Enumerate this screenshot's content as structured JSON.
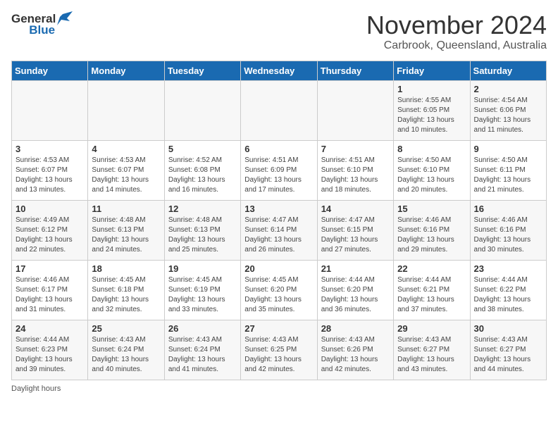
{
  "header": {
    "logo_general": "General",
    "logo_blue": "Blue",
    "title": "November 2024",
    "subtitle": "Carbrook, Queensland, Australia"
  },
  "days_of_week": [
    "Sunday",
    "Monday",
    "Tuesday",
    "Wednesday",
    "Thursday",
    "Friday",
    "Saturday"
  ],
  "weeks": [
    [
      {
        "day": "",
        "info": ""
      },
      {
        "day": "",
        "info": ""
      },
      {
        "day": "",
        "info": ""
      },
      {
        "day": "",
        "info": ""
      },
      {
        "day": "",
        "info": ""
      },
      {
        "day": "1",
        "info": "Sunrise: 4:55 AM\nSunset: 6:05 PM\nDaylight: 13 hours and 10 minutes."
      },
      {
        "day": "2",
        "info": "Sunrise: 4:54 AM\nSunset: 6:06 PM\nDaylight: 13 hours and 11 minutes."
      }
    ],
    [
      {
        "day": "3",
        "info": "Sunrise: 4:53 AM\nSunset: 6:07 PM\nDaylight: 13 hours and 13 minutes."
      },
      {
        "day": "4",
        "info": "Sunrise: 4:53 AM\nSunset: 6:07 PM\nDaylight: 13 hours and 14 minutes."
      },
      {
        "day": "5",
        "info": "Sunrise: 4:52 AM\nSunset: 6:08 PM\nDaylight: 13 hours and 16 minutes."
      },
      {
        "day": "6",
        "info": "Sunrise: 4:51 AM\nSunset: 6:09 PM\nDaylight: 13 hours and 17 minutes."
      },
      {
        "day": "7",
        "info": "Sunrise: 4:51 AM\nSunset: 6:10 PM\nDaylight: 13 hours and 18 minutes."
      },
      {
        "day": "8",
        "info": "Sunrise: 4:50 AM\nSunset: 6:10 PM\nDaylight: 13 hours and 20 minutes."
      },
      {
        "day": "9",
        "info": "Sunrise: 4:50 AM\nSunset: 6:11 PM\nDaylight: 13 hours and 21 minutes."
      }
    ],
    [
      {
        "day": "10",
        "info": "Sunrise: 4:49 AM\nSunset: 6:12 PM\nDaylight: 13 hours and 22 minutes."
      },
      {
        "day": "11",
        "info": "Sunrise: 4:48 AM\nSunset: 6:13 PM\nDaylight: 13 hours and 24 minutes."
      },
      {
        "day": "12",
        "info": "Sunrise: 4:48 AM\nSunset: 6:13 PM\nDaylight: 13 hours and 25 minutes."
      },
      {
        "day": "13",
        "info": "Sunrise: 4:47 AM\nSunset: 6:14 PM\nDaylight: 13 hours and 26 minutes."
      },
      {
        "day": "14",
        "info": "Sunrise: 4:47 AM\nSunset: 6:15 PM\nDaylight: 13 hours and 27 minutes."
      },
      {
        "day": "15",
        "info": "Sunrise: 4:46 AM\nSunset: 6:16 PM\nDaylight: 13 hours and 29 minutes."
      },
      {
        "day": "16",
        "info": "Sunrise: 4:46 AM\nSunset: 6:16 PM\nDaylight: 13 hours and 30 minutes."
      }
    ],
    [
      {
        "day": "17",
        "info": "Sunrise: 4:46 AM\nSunset: 6:17 PM\nDaylight: 13 hours and 31 minutes."
      },
      {
        "day": "18",
        "info": "Sunrise: 4:45 AM\nSunset: 6:18 PM\nDaylight: 13 hours and 32 minutes."
      },
      {
        "day": "19",
        "info": "Sunrise: 4:45 AM\nSunset: 6:19 PM\nDaylight: 13 hours and 33 minutes."
      },
      {
        "day": "20",
        "info": "Sunrise: 4:45 AM\nSunset: 6:20 PM\nDaylight: 13 hours and 35 minutes."
      },
      {
        "day": "21",
        "info": "Sunrise: 4:44 AM\nSunset: 6:20 PM\nDaylight: 13 hours and 36 minutes."
      },
      {
        "day": "22",
        "info": "Sunrise: 4:44 AM\nSunset: 6:21 PM\nDaylight: 13 hours and 37 minutes."
      },
      {
        "day": "23",
        "info": "Sunrise: 4:44 AM\nSunset: 6:22 PM\nDaylight: 13 hours and 38 minutes."
      }
    ],
    [
      {
        "day": "24",
        "info": "Sunrise: 4:44 AM\nSunset: 6:23 PM\nDaylight: 13 hours and 39 minutes."
      },
      {
        "day": "25",
        "info": "Sunrise: 4:43 AM\nSunset: 6:24 PM\nDaylight: 13 hours and 40 minutes."
      },
      {
        "day": "26",
        "info": "Sunrise: 4:43 AM\nSunset: 6:24 PM\nDaylight: 13 hours and 41 minutes."
      },
      {
        "day": "27",
        "info": "Sunrise: 4:43 AM\nSunset: 6:25 PM\nDaylight: 13 hours and 42 minutes."
      },
      {
        "day": "28",
        "info": "Sunrise: 4:43 AM\nSunset: 6:26 PM\nDaylight: 13 hours and 42 minutes."
      },
      {
        "day": "29",
        "info": "Sunrise: 4:43 AM\nSunset: 6:27 PM\nDaylight: 13 hours and 43 minutes."
      },
      {
        "day": "30",
        "info": "Sunrise: 4:43 AM\nSunset: 6:27 PM\nDaylight: 13 hours and 44 minutes."
      }
    ]
  ],
  "footer": {
    "daylight_label": "Daylight hours"
  }
}
